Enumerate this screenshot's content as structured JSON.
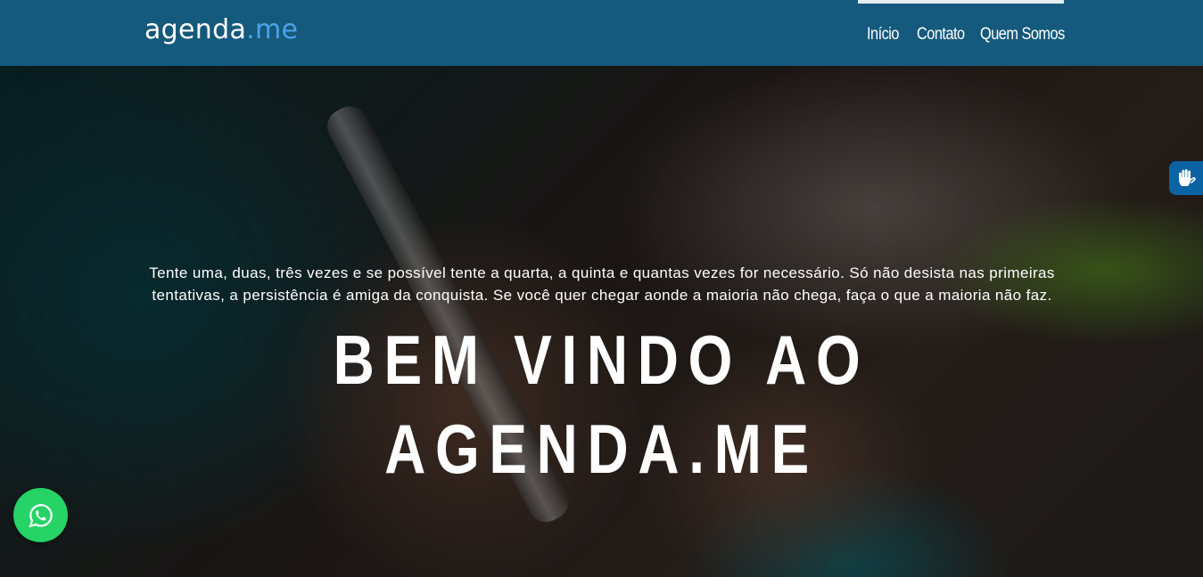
{
  "header": {
    "logo_main": "agenda",
    "logo_accent": ".me",
    "nav": [
      {
        "label": "Início"
      },
      {
        "label": "Contato"
      },
      {
        "label": "Quem Somos"
      }
    ]
  },
  "hero": {
    "quote": "Tente uma, duas, três vezes e se possível tente a quarta, a quinta e quantas vezes for necessário. Só não desista nas primeiras tentativas, a persistência é amiga da conquista. Se você quer chegar aonde a maioria não chega, faça o que a maioria não faz.",
    "title": "BEM VINDO AO AGENDA.ME"
  },
  "widgets": {
    "accessibility_icon": "hands-sign-language-icon",
    "chat_icon": "whatsapp-icon"
  },
  "colors": {
    "navbar": "#155a7c",
    "logo_accent": "#4aa3ea",
    "whatsapp": "#25d366",
    "vlibras": "#0b63a3"
  }
}
